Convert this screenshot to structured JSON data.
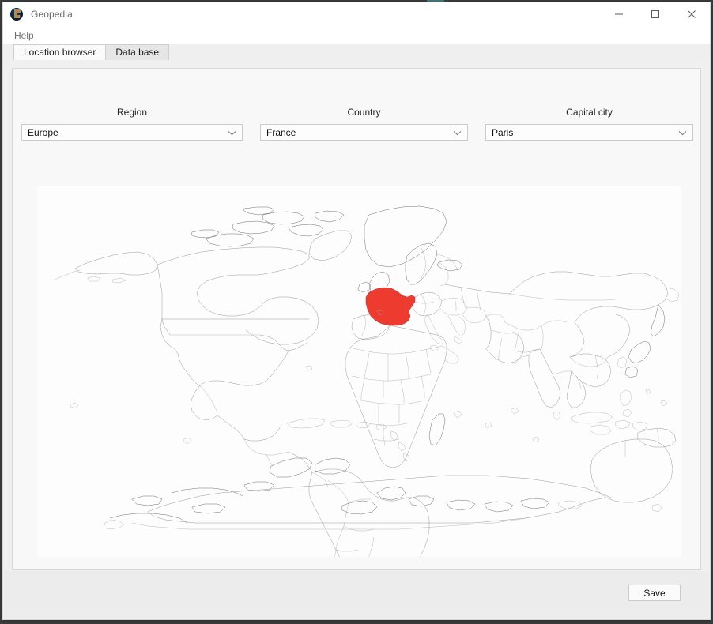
{
  "window": {
    "title": "Geopedia",
    "app_icon": "globe-icon",
    "controls": [
      {
        "name": "minimize-button",
        "glyph": "minimize-icon"
      },
      {
        "name": "maximize-button",
        "glyph": "maximize-icon"
      },
      {
        "name": "close-button",
        "glyph": "close-icon"
      }
    ]
  },
  "menubar": {
    "items": [
      {
        "label": "Help"
      }
    ]
  },
  "tabs": [
    {
      "label": "Location browser",
      "active": true
    },
    {
      "label": "Data base",
      "active": false
    }
  ],
  "selectors": [
    {
      "name": "region",
      "label": "Region",
      "value": "Europe",
      "arrow_icon": "chevron-down-icon"
    },
    {
      "name": "country",
      "label": "Country",
      "value": "France",
      "arrow_icon": "chevron-down-icon"
    },
    {
      "name": "capital-city",
      "label": "Capital city",
      "value": "Paris",
      "arrow_icon": "chevron-down-icon"
    }
  ],
  "map": {
    "name": "world-map",
    "highlighted_country": "France",
    "highlight_color": "#ED3B2F",
    "outline_color": "#8D8D8D",
    "background_color": "#FDFDFE"
  },
  "footer": {
    "save_label": "Save"
  },
  "colors": {
    "titlebar_background": "#FFFFFF",
    "window_background": "#F0F0F0",
    "panel_background": "#F8F8F8",
    "footer_background": "#ECECEC",
    "accent_red": "#ED3B2F",
    "text_primary": "#1A1A1A",
    "text_muted": "#6E6E6E"
  }
}
